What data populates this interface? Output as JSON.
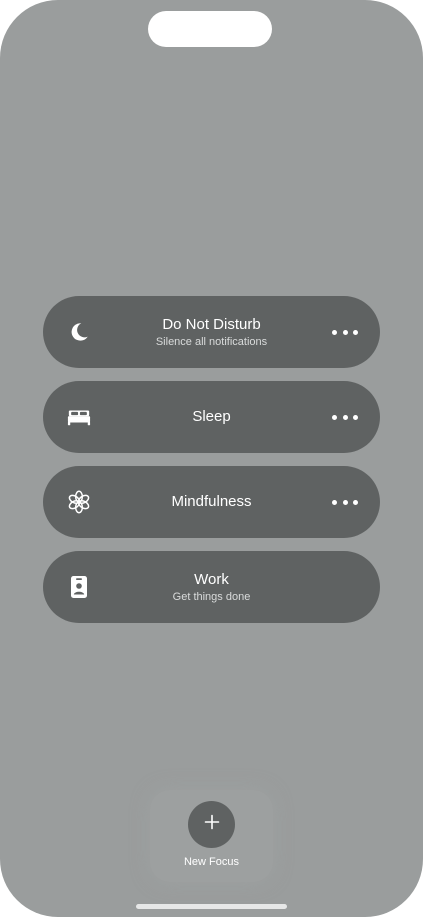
{
  "focus_modes": [
    {
      "icon": "moon-icon",
      "title": "Do Not Disturb",
      "subtitle": "Silence all notifications",
      "has_more": true
    },
    {
      "icon": "bed-icon",
      "title": "Sleep",
      "subtitle": "",
      "has_more": true
    },
    {
      "icon": "mindfulness-flower-icon",
      "title": "Mindfulness",
      "subtitle": "",
      "has_more": true
    },
    {
      "icon": "id-badge-icon",
      "title": "Work",
      "subtitle": "Get things done",
      "has_more": false
    }
  ],
  "new_focus": {
    "label": "New Focus",
    "icon": "plus-icon"
  },
  "colors": {
    "background": "#9a9d9d",
    "card": "#5f6262",
    "text": "#ffffff"
  }
}
